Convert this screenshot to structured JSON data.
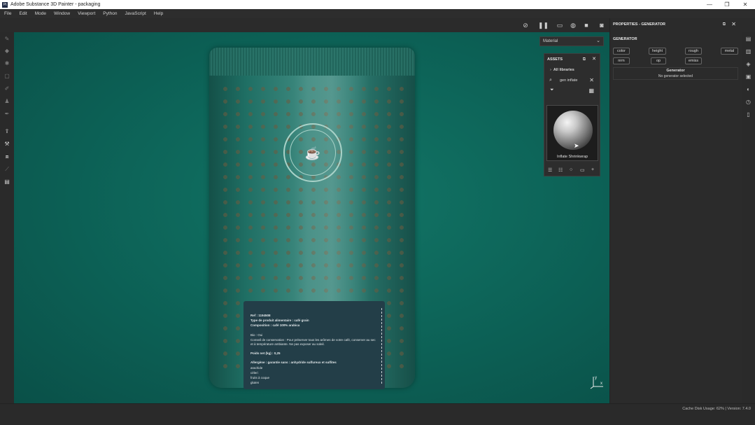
{
  "window": {
    "title": "Adobe Substance 3D Painter - packaging",
    "app_icon": "Pt",
    "controls": {
      "minimize": "—",
      "restore": "❐",
      "close": "✕"
    }
  },
  "menu": [
    "File",
    "Edit",
    "Mode",
    "Window",
    "Viewport",
    "Python",
    "JavaScript",
    "Help"
  ],
  "toolbar_icons": [
    "hide-icon",
    "pause-icon",
    "view-mode-icon",
    "environment-icon",
    "camera-icon",
    "screenshot-icon"
  ],
  "left_tools": [
    "paint-icon",
    "eraser-icon",
    "projection-icon",
    "geometry-mask-icon",
    "smudge-icon",
    "clone-icon",
    "color-picker-icon",
    "export-icon",
    "bake-icon",
    "texture-set-icon",
    "uv-icon",
    "shelf-icon"
  ],
  "viewport": {
    "material_select": "Material",
    "label": {
      "ref": "Ref : 1194508",
      "type": "Type de produit alimentaire : café grain",
      "composition": "Composition : café 100% arabica",
      "bio": "Bio : Oui",
      "conservation": "Conseil de conservation : Pour préserver tous les arômes de votre café, conserver au sec et à température ambiante. Ne pas exposer au soleil.",
      "weight": "Poids net (kg) : 0,25",
      "allergens_title": "Allergène : garantie sans : anhydride sulfureux et sulfites",
      "allergens": [
        "arachide",
        "céleri",
        "fruits à coque",
        "gluten"
      ]
    }
  },
  "assets": {
    "title": "ASSETS",
    "library": "All libraries",
    "search_value": "gen inflate",
    "item_name": "Inflate Shrinkwrap"
  },
  "properties": {
    "title": "PROPERTIES - GENERATOR",
    "section": "GENERATOR",
    "channels": [
      "color",
      "height",
      "rough",
      "metal",
      "nrm",
      "op",
      "emiss"
    ],
    "generator_title": "Generator",
    "generator_status": "No generator selected"
  },
  "right_tools": [
    "texture-set-list-icon",
    "texture-set-settings-icon",
    "layers-icon",
    "display-settings-icon",
    "shader-settings-icon",
    "history-icon",
    "log-icon"
  ],
  "status": {
    "text": "Cache Disk Usage:   62% | Version: 7.4.0"
  },
  "gizmo": {
    "x": "x",
    "y": "y"
  }
}
